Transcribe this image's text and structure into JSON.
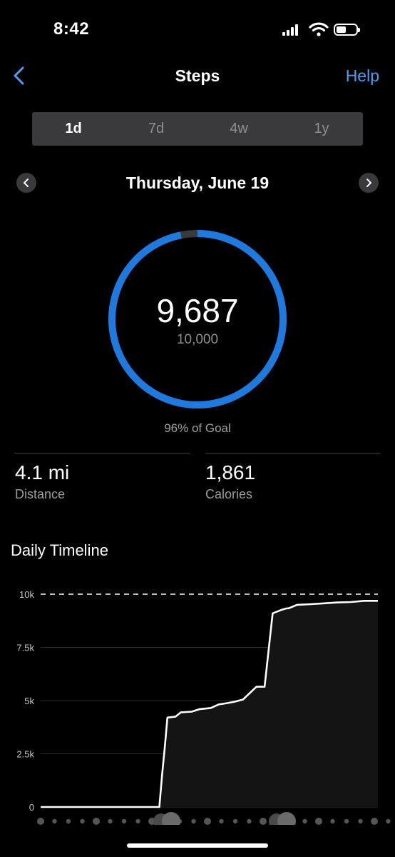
{
  "status_bar": {
    "time": "8:42"
  },
  "nav": {
    "title": "Steps",
    "help": "Help"
  },
  "tabs": [
    {
      "label": "1d",
      "active": true
    },
    {
      "label": "7d",
      "active": false
    },
    {
      "label": "4w",
      "active": false
    },
    {
      "label": "1y",
      "active": false
    }
  ],
  "date": "Thursday, June 19",
  "summary": {
    "steps": "9,687",
    "goal": "10,000",
    "percent_of_goal": "96% of Goal",
    "progress": 0.9687
  },
  "stats": {
    "distance_value": "4.1 mi",
    "distance_label": "Distance",
    "calories_value": "1,861",
    "calories_label": "Calories"
  },
  "timeline": {
    "title": "Daily Timeline"
  },
  "colors": {
    "accent": "#1f7ae0",
    "link": "#4c9ff0",
    "ring_remaining": "#3a3a3c"
  },
  "chart_data": {
    "type": "line",
    "title": "Daily Timeline",
    "xlabel": "",
    "ylabel": "",
    "ylim": [
      0,
      10000
    ],
    "yticks": [
      "0",
      "2.5k",
      "5k",
      "7.5k",
      "10k"
    ],
    "goal_line": 10000,
    "x": [
      0,
      4.4,
      4.5,
      4.6,
      4.7,
      5.0,
      5.2,
      5.6,
      5.9,
      6.3,
      6.6,
      6.9,
      7.2,
      7.5,
      8.0,
      8.3,
      8.6,
      8.9,
      9.1,
      9.2,
      9.5,
      10.0,
      10.5,
      11.0,
      11.5,
      12.0,
      12.5
    ],
    "series": [
      {
        "values": [
          0,
          0,
          1500,
          2800,
          4200,
          4250,
          4450,
          4480,
          4600,
          4650,
          4820,
          4880,
          4950,
          5050,
          5650,
          5650,
          9100,
          9250,
          9330,
          9340,
          9500,
          9530,
          9570,
          9610,
          9630,
          9687,
          9687
        ]
      }
    ]
  }
}
